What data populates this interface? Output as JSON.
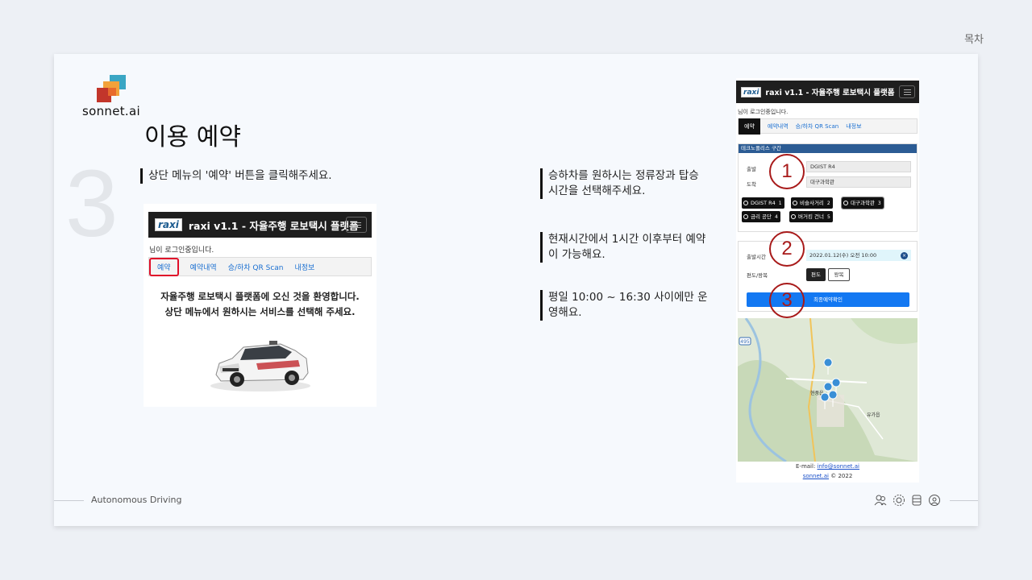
{
  "header": {
    "toc_label": "목차"
  },
  "logo": {
    "text": "sonnet.ai"
  },
  "slide": {
    "section_number": "3",
    "title": "이용 예약",
    "callouts": [
      "상단 메뉴의 '예약' 버튼을 클릭해주세요.",
      "승하차를 원하시는 정류장과 탑승 시간을 선택해주세요.",
      "현재시간에서 1시간 이후부터 예약이 가능해요.",
      "평일 10:00 ~ 16:30 사이에만 운영해요."
    ]
  },
  "screenshot_home": {
    "brand": "raxi",
    "navbar_title": "raxi v1.1 - 자율주행 로보택시 플랫폼",
    "login_text": "님이 로그인중입니다.",
    "tabs": [
      "예약",
      "예약내역",
      "승/하차 QR Scan",
      "내정보"
    ],
    "welcome_line1": "자율주행 로보택시 플랫폼에 오신 것을 환영합니다.",
    "welcome_line2": "상단 메뉴에서 원하시는 서비스를 선택해 주세요."
  },
  "screenshot_booking": {
    "brand": "raxi",
    "navbar_title": "raxi v1.1 - 자율주행 로보택시 플랫폼",
    "login_text": "님이 로그인중입니다.",
    "tabs": [
      "예약",
      "예약내역",
      "승/하차 QR Scan",
      "내정보"
    ],
    "section_header": "테크노폴리스 구간",
    "departure_label": "출발",
    "departure_value": "DGIST R4",
    "arrival_label": "도착",
    "arrival_value": "대구과학관",
    "stops": [
      {
        "name": "DGIST R4",
        "num": "1"
      },
      {
        "name": "비슬사거리",
        "num": "2"
      },
      {
        "name": "대구과학관",
        "num": "3"
      },
      {
        "name": "금리 공단",
        "num": "4"
      },
      {
        "name": "버거킹 건너",
        "num": "5"
      }
    ],
    "time_label": "출발시간",
    "time_value": "2022.01.12(수) 오전 10:00",
    "trip_label": "편도/왕복",
    "oneway_label": "편도",
    "roundtrip_label": "왕복",
    "final_button": "최종예약확인",
    "footer_email_label": "E-mail:",
    "footer_email": "info@sonnet.ai",
    "footer_site": "sonnet.ai",
    "footer_year": "© 2022"
  },
  "markers": [
    "1",
    "2",
    "3"
  ],
  "map_labels": {
    "route": "495",
    "town1": "현풍읍",
    "town2": "유가읍"
  },
  "footer": {
    "text": "Autonomous Driving"
  },
  "colors": {
    "accent_red": "#a81a1a",
    "nav_dark": "#1e1e1e",
    "blue": "#1378f2"
  }
}
